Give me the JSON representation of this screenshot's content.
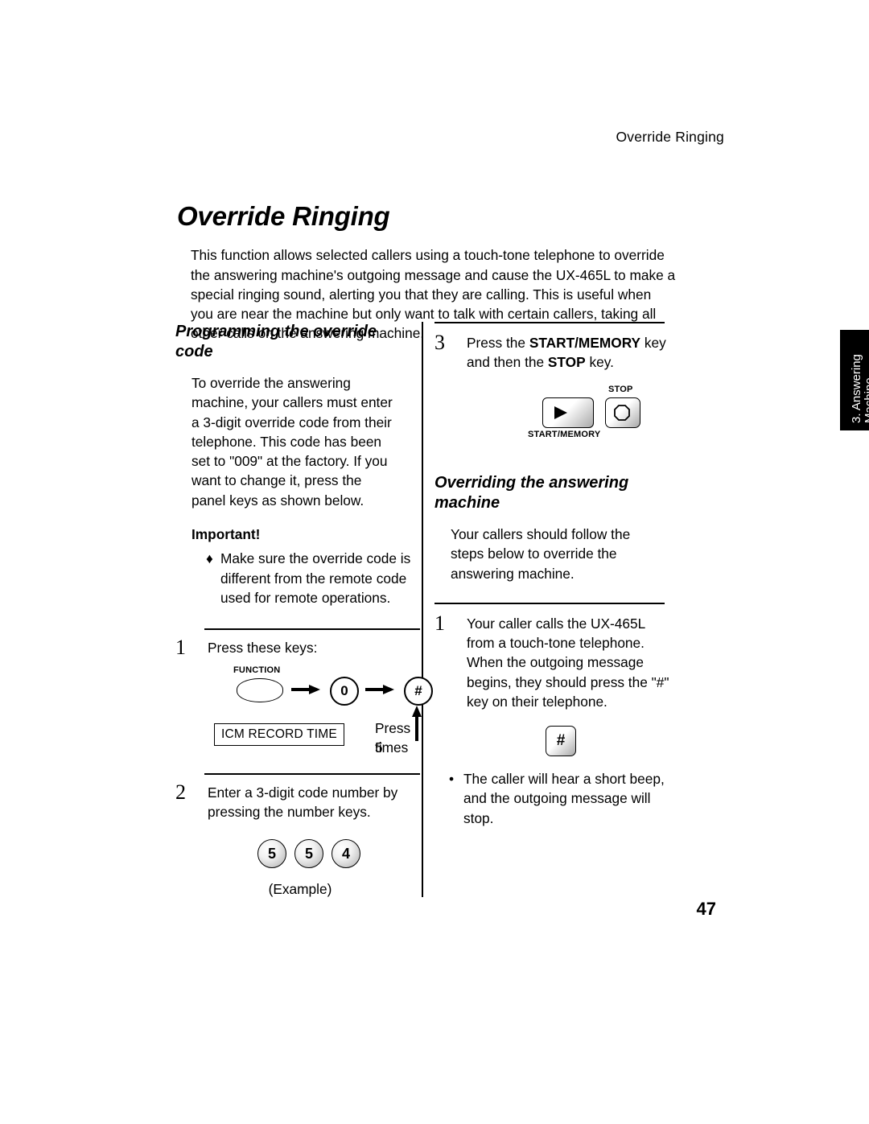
{
  "running_head": "Override Ringing",
  "title": "Override Ringing",
  "intro": "This function allows selected callers using a touch-tone telephone to override the answering machine's outgoing message and cause the UX-465L to make a special ringing sound, alerting you that they are calling. This is useful when you are near the machine but only want to talk with certain callers, taking all other calls on the answering machine.",
  "left_column": {
    "heading": "Programming the override code",
    "paragraph": "To override the answering machine, your callers must enter a 3-digit override code from their telephone. This code has been set to \"009\" at the factory. If you want to change it, press the panel keys as shown below.",
    "important_label": "Important!",
    "important_bullet_mark": "♦",
    "important_bullet": "Make sure the override code is different from the remote code used for remote operations.",
    "step1": {
      "number": "1",
      "text": "Press these keys:",
      "function_label": "FUNCTION",
      "key_zero": "0",
      "key_hash": "#",
      "icm_box": "ICM RECORD TIME",
      "press_times_line1": "Press 5",
      "press_times_line2": "times"
    },
    "step2": {
      "number": "2",
      "text": "Enter a 3-digit code number by pressing the number keys.",
      "keys": [
        "5",
        "5",
        "4"
      ],
      "example": "(Example)"
    }
  },
  "right_column": {
    "step3": {
      "number": "3",
      "text_before": "Press the ",
      "bold1": "START/MEMORY",
      "text_middle": " key and then the ",
      "bold2": "STOP",
      "text_after": " key.",
      "start_memory_label": "START/MEMORY",
      "stop_label": "STOP"
    },
    "heading": "Overriding the answering machine",
    "paragraph": "Your callers should follow the steps below to override the answering machine.",
    "step1": {
      "number": "1",
      "text": "Your caller calls the UX-465L from a touch-tone telephone. When the outgoing message begins, they should press the \"#\" key on their telephone.",
      "hash_key": "#"
    },
    "bullet_mark": "•",
    "bullet": "The caller will hear a short beep, and the outgoing message will stop."
  },
  "side_tab": {
    "line1": "3. Answering",
    "line2": "Machine"
  },
  "page_number": "47"
}
